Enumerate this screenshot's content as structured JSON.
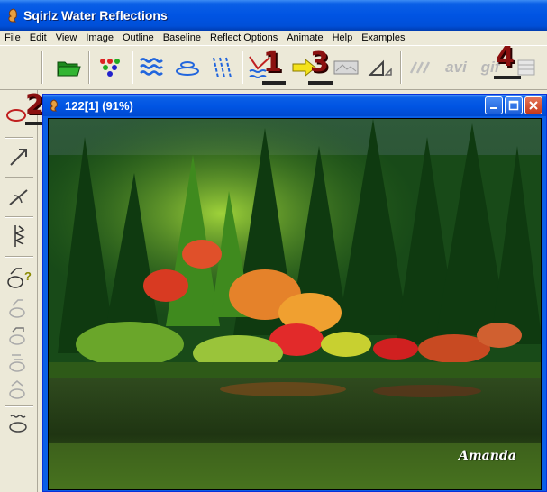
{
  "app": {
    "title": "Sqirlz Water Reflections"
  },
  "menu": {
    "items": [
      "File",
      "Edit",
      "View",
      "Image",
      "Outline",
      "Baseline",
      "Reflect Options",
      "Animate",
      "Help",
      "Examples"
    ]
  },
  "toolbar": {
    "avi_label": "avi",
    "gif_label": "gif"
  },
  "callouts": {
    "c1": "1",
    "c2": "2",
    "c3": "3",
    "c4": "4"
  },
  "document": {
    "title": "122[1]  (91%)",
    "watermark": "Amanda"
  },
  "colors": {
    "titlebar": "#0054e3",
    "callout": "#8b1010",
    "chrome": "#ece9d8"
  }
}
